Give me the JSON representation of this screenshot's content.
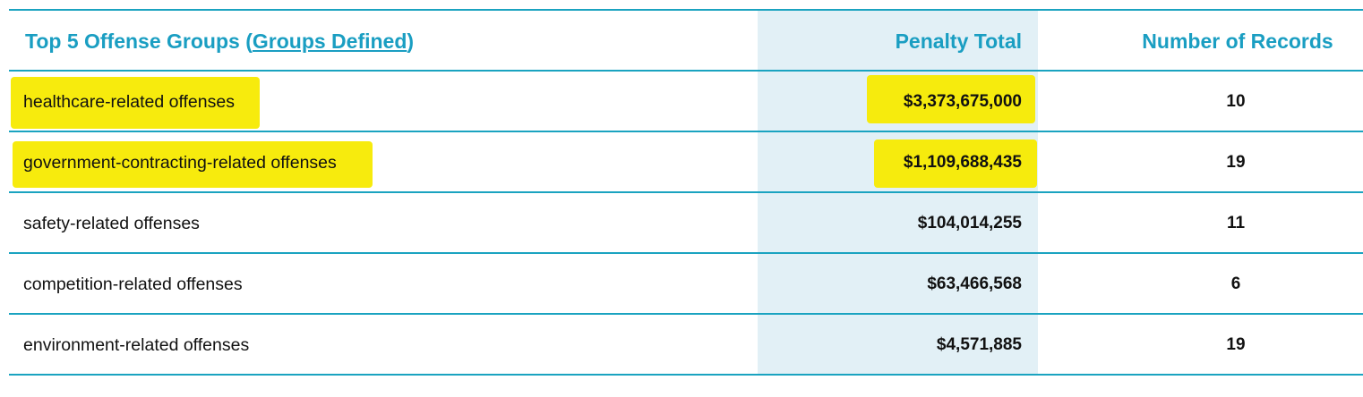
{
  "table": {
    "header": {
      "group_prefix": "Top 5 Offense Groups (",
      "group_link": "Groups Defined",
      "group_suffix": ")",
      "penalty": "Penalty Total",
      "records": "Number of Records"
    },
    "rows": [
      {
        "name": "healthcare-related offenses",
        "penalty": "$3,373,675,000",
        "records": "10",
        "highlighted": true
      },
      {
        "name": "government-contracting-related offenses",
        "penalty": "$1,109,688,435",
        "records": "19",
        "highlighted": true
      },
      {
        "name": "safety-related offenses",
        "penalty": "$104,014,255",
        "records": "11",
        "highlighted": false
      },
      {
        "name": "competition-related offenses",
        "penalty": "$63,466,568",
        "records": "6",
        "highlighted": false
      },
      {
        "name": "environment-related offenses",
        "penalty": "$4,571,885",
        "records": "19",
        "highlighted": false
      }
    ]
  },
  "colors": {
    "accent": "#1aa3c0",
    "header_text": "#1a9ec2",
    "penalty_column_bg": "#e2f0f6",
    "highlight": "#f7ea00"
  }
}
